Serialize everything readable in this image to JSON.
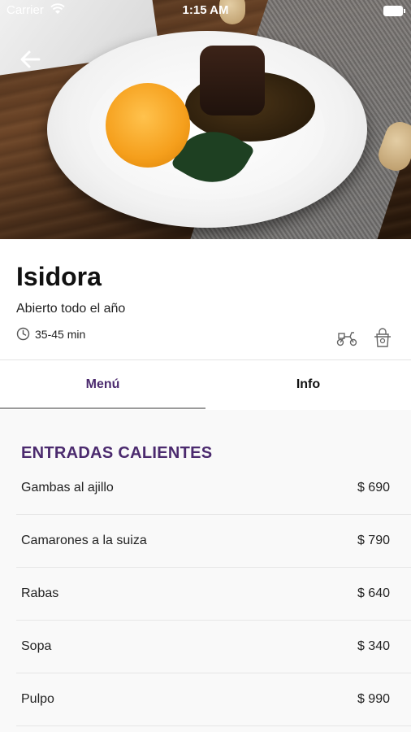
{
  "status_bar": {
    "carrier": "Carrier",
    "time": "1:15 AM"
  },
  "restaurant": {
    "name": "Isidora",
    "subtitle": "Abierto todo el año",
    "eta": "35-45 min"
  },
  "icons": {
    "back": "arrow-left-icon",
    "clock": "clock-icon",
    "delivery": "scooter-icon",
    "takeaway": "takeaway-bag-icon"
  },
  "tabs": [
    {
      "label": "Menú",
      "active": true
    },
    {
      "label": "Info",
      "active": false
    }
  ],
  "menu": {
    "section_title": "ENTRADAS CALIENTES",
    "items": [
      {
        "name": "Gambas al ajillo",
        "price": "$ 690"
      },
      {
        "name": "Camarones a la suiza",
        "price": "$ 790"
      },
      {
        "name": "Rabas",
        "price": "$ 640"
      },
      {
        "name": "Sopa",
        "price": "$ 340"
      },
      {
        "name": "Pulpo",
        "price": "$ 990"
      }
    ]
  },
  "colors": {
    "accent": "#4b2a6e",
    "divider": "#e3e3e3",
    "menu_bg": "#f9f9f9"
  }
}
